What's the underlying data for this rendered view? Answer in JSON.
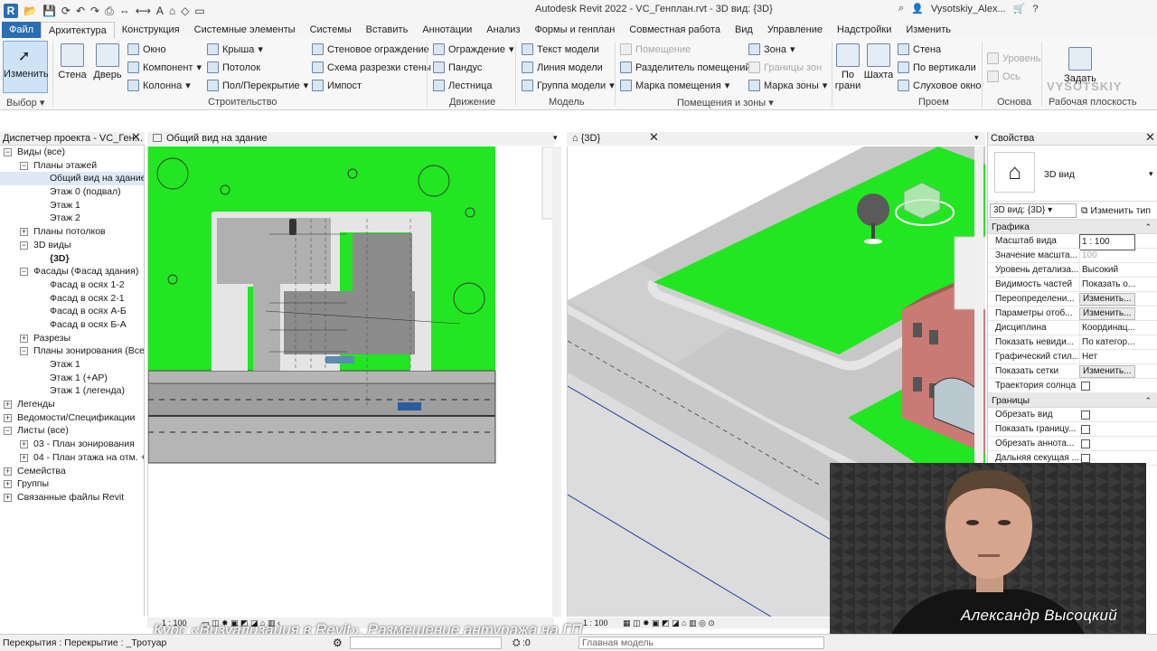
{
  "window": {
    "title": "Autodesk Revit 2022 - VC_Генплан.rvt - 3D вид: {3D}",
    "user": "Vysotskiy_Alex...",
    "logo_letter": "R"
  },
  "tabs": [
    "Файл",
    "Архитектура",
    "Конструкция",
    "Системные элементы",
    "Системы",
    "Вставить",
    "Аннотации",
    "Анализ",
    "Формы и генплан",
    "Совместная работа",
    "Вид",
    "Управление",
    "Надстройки",
    "Изменить"
  ],
  "ribbon": {
    "modify": "Изменить",
    "select_group": "Выбор",
    "wall": "Стена",
    "door": "Дверь",
    "window": "Окно",
    "component": "Компонент",
    "column": "Колонна",
    "roof": "Крыша",
    "ceiling": "Потолок",
    "floor": "Пол/Перекрытие",
    "curtain_wall": "Стеновое ограждение",
    "curtain_grid": "Схема разрезки стены",
    "mullion": "Импост",
    "build_group": "Строительство",
    "railing": "Ограждение",
    "ramp": "Пандус",
    "stair": "Лестница",
    "circulation_group": "Движение",
    "model_text": "Текст модели",
    "model_line": "Линия модели",
    "model_group": "Группа модели",
    "model_group_label": "Модель",
    "room": "Помещение",
    "room_separator": "Разделитель помещений",
    "room_tag": "Марка помещения",
    "area": "Зона",
    "area_boundary": "Границы зон",
    "area_tag": "Марка зоны",
    "rooms_group": "Помещения и зоны",
    "by_face": "По грани",
    "shaft": "Шахта",
    "opening_wall": "Стена",
    "vertical": "По вертикали",
    "dormer": "Слуховое окно",
    "opening_group": "Проем",
    "level": "Уровень",
    "grid": "Ось",
    "datum_group": "Основа",
    "set": "Задать",
    "workplane_group": "Рабочая плоскость",
    "watermark": "VYSOTSKIY"
  },
  "browser": {
    "title": "Диспетчер проекта - VC_Ген...",
    "nodes": [
      {
        "label": "Виды (все)",
        "level": 0,
        "toggle": "-"
      },
      {
        "label": "Планы этажей",
        "level": 1,
        "toggle": "-"
      },
      {
        "label": "Общий вид на здание",
        "level": 2,
        "toggle": "",
        "selected": true
      },
      {
        "label": "Этаж 0 (подвал)",
        "level": 2,
        "toggle": ""
      },
      {
        "label": "Этаж 1",
        "level": 2,
        "toggle": ""
      },
      {
        "label": "Этаж 2",
        "level": 2,
        "toggle": ""
      },
      {
        "label": "Планы потолков",
        "level": 1,
        "toggle": "+"
      },
      {
        "label": "3D виды",
        "level": 1,
        "toggle": "-"
      },
      {
        "label": "{3D}",
        "level": 2,
        "toggle": "",
        "bold": true
      },
      {
        "label": "Фасады (Фасад здания)",
        "level": 1,
        "toggle": "-"
      },
      {
        "label": "Фасад в осях 1-2",
        "level": 2,
        "toggle": ""
      },
      {
        "label": "Фасад в осях 2-1",
        "level": 2,
        "toggle": ""
      },
      {
        "label": "Фасад в осях А-Б",
        "level": 2,
        "toggle": ""
      },
      {
        "label": "Фасад в осях Б-А",
        "level": 2,
        "toggle": ""
      },
      {
        "label": "Разрезы",
        "level": 1,
        "toggle": "+"
      },
      {
        "label": "Планы зонирования (Все",
        "level": 1,
        "toggle": "-"
      },
      {
        "label": "Этаж 1",
        "level": 2,
        "toggle": ""
      },
      {
        "label": "Этаж 1 (+АР)",
        "level": 2,
        "toggle": ""
      },
      {
        "label": "Этаж 1 (легенда)",
        "level": 2,
        "toggle": ""
      },
      {
        "label": "Легенды",
        "level": 0,
        "toggle": "+"
      },
      {
        "label": "Ведомости/Спецификации",
        "level": 0,
        "toggle": "+"
      },
      {
        "label": "Листы (все)",
        "level": 0,
        "toggle": "-"
      },
      {
        "label": "03 - План зонирования",
        "level": 1,
        "toggle": "+"
      },
      {
        "label": "04 - План этажа на отм. +",
        "level": 1,
        "toggle": "+"
      },
      {
        "label": "Семейства",
        "level": 0,
        "toggle": "+"
      },
      {
        "label": "Группы",
        "level": 0,
        "toggle": "+"
      },
      {
        "label": "Связанные файлы Revit",
        "level": 0,
        "toggle": "+"
      }
    ]
  },
  "views": {
    "left_tab": "Общий вид на здание",
    "right_tab": "{3D}",
    "left_scale": "1 : 100",
    "right_scale": "1 : 100"
  },
  "properties": {
    "title": "Свойства",
    "type_name": "3D вид",
    "selector": "3D вид: {3D}",
    "edit_type": "Изменить тип",
    "sections": [
      {
        "name": "Графика",
        "rows": [
          {
            "k": "Масштаб вида",
            "v": "1 : 100",
            "kind": "input"
          },
          {
            "k": "Значение масшта...",
            "v": "100",
            "kind": "dis"
          },
          {
            "k": "Уровень детализа...",
            "v": "Высокий",
            "kind": "text"
          },
          {
            "k": "Видимость частей",
            "v": "Показать о...",
            "kind": "text"
          },
          {
            "k": "Переопределени...",
            "v": "Изменить...",
            "kind": "btn"
          },
          {
            "k": "Параметры отоб...",
            "v": "Изменить...",
            "kind": "btn"
          },
          {
            "k": "Дисциплина",
            "v": "Координац...",
            "kind": "text"
          },
          {
            "k": "Показать невиди...",
            "v": "По категор...",
            "kind": "text"
          },
          {
            "k": "Графический стил...",
            "v": "Нет",
            "kind": "text"
          },
          {
            "k": "Показать сетки",
            "v": "Изменить...",
            "kind": "btn"
          },
          {
            "k": "Траектория солнца",
            "v": "",
            "kind": "check"
          }
        ]
      },
      {
        "name": "Границы",
        "rows": [
          {
            "k": "Обрезать вид",
            "v": "",
            "kind": "check"
          },
          {
            "k": "Показать границу...",
            "v": "",
            "kind": "check"
          },
          {
            "k": "Обрезать аннота...",
            "v": "",
            "kind": "check"
          },
          {
            "k": "Дальняя секущая ...",
            "v": "",
            "kind": "check"
          }
        ]
      }
    ]
  },
  "status": {
    "left": "Перекрытия : Перекрытие : _Тротуар",
    "count": ":0",
    "model": "Главная модель"
  },
  "presenter": {
    "name": "Александр Высоцкий",
    "caption": "Курс «Визуализация в Revit». Размещение антуража на ГП"
  },
  "colors": {
    "accent": "#2b6db3",
    "grass": "#22e622",
    "road": "#b5b5b5",
    "paving": "#8c8c8c"
  }
}
